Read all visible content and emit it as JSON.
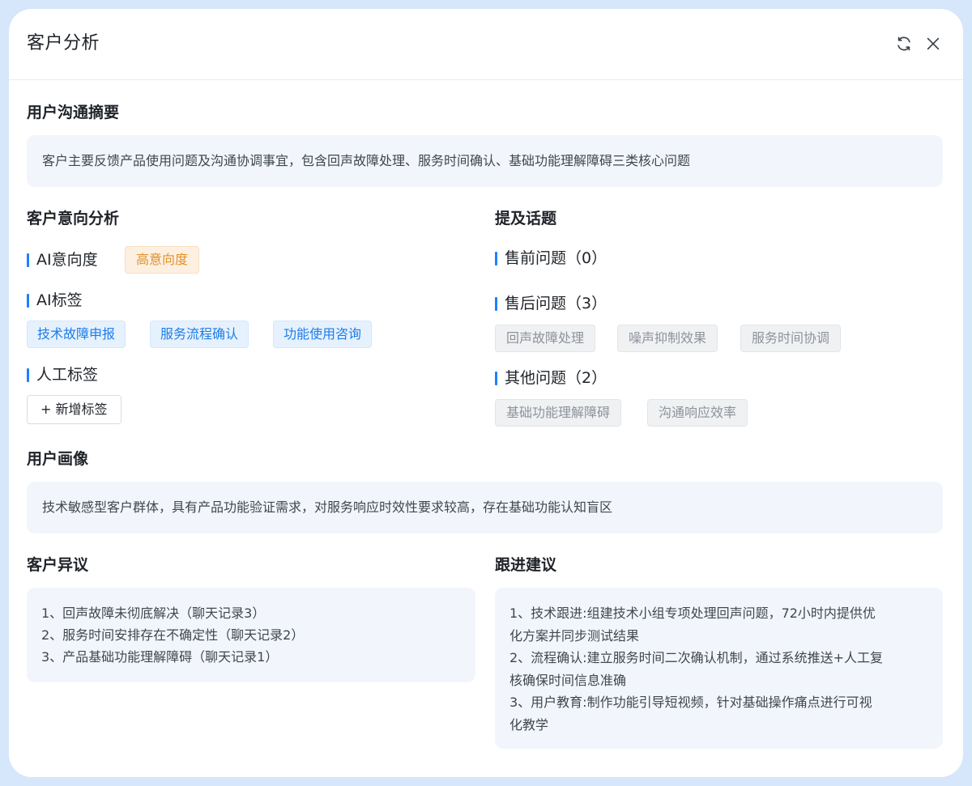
{
  "header": {
    "title": "客户分析",
    "refresh_icon": "refresh-icon",
    "close_icon": "close-icon"
  },
  "summary": {
    "title": "用户沟通摘要",
    "text": "客户主要反馈产品使用问题及沟通协调事宜，包含回声故障处理、服务时间确认、基础功能理解障碍三类核心问题"
  },
  "intent": {
    "title": "客户意向分析",
    "ai_intent_label": "AI意向度",
    "ai_intent_value": "高意向度",
    "ai_tags_label": "AI标签",
    "ai_tags": [
      "技术故障申报",
      "服务流程确认",
      "功能使用咨询"
    ],
    "manual_tags_label": "人工标签",
    "add_tag_label": "+ 新增标签"
  },
  "topics": {
    "title": "提及话题",
    "presale_label": "售前问题（0）",
    "aftersale_label": "售后问题（3）",
    "aftersale_tags": [
      "回声故障处理",
      "噪声抑制效果",
      "服务时间协调"
    ],
    "other_label": "其他问题（2）",
    "other_tags": [
      "基础功能理解障碍",
      "沟通响应效率"
    ]
  },
  "persona": {
    "title": "用户画像",
    "text": "技术敏感型客户群体，具有产品功能验证需求，对服务响应时效性要求较高，存在基础功能认知盲区"
  },
  "objections": {
    "title": "客户异议",
    "items": [
      "1、回声故障未彻底解决（聊天记录3）",
      "2、服务时间安排存在不确定性（聊天记录2）",
      "3、产品基础功能理解障碍（聊天记录1）"
    ]
  },
  "followup": {
    "title": "跟进建议",
    "lines": [
      "1、技术跟进:组建技术小组专项处理回声问题，72小时内提供优",
      "化方案并同步测试结果",
      "2、流程确认:建立服务时间二次确认机制，通过系统推送+人工复",
      "核确保时间信息准确",
      "3、用户教育:制作功能引导短视频，针对基础操作痛点进行可视",
      "化教学"
    ]
  },
  "colors": {
    "accent": "#1e80ff",
    "frame_bg": "#d6e6fb",
    "box_bg": "#f2f6fc",
    "intent_orange": "#e0922b"
  }
}
